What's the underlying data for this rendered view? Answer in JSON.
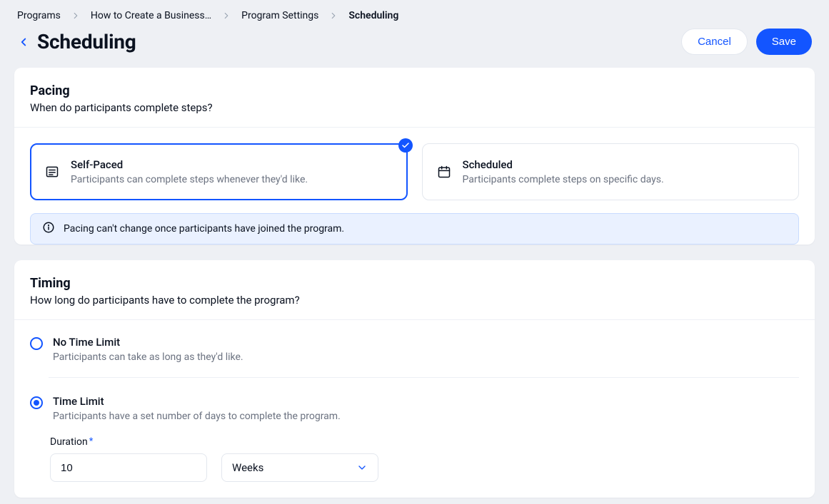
{
  "colors": {
    "accent": "#1355ff"
  },
  "breadcrumb": {
    "items": [
      {
        "label": "Programs"
      },
      {
        "label": "How to Create a Business…"
      },
      {
        "label": "Program Settings"
      },
      {
        "label": "Scheduling"
      }
    ]
  },
  "header": {
    "title": "Scheduling",
    "cancel_label": "Cancel",
    "save_label": "Save"
  },
  "pacing": {
    "heading": "Pacing",
    "subheading": "When do participants complete steps?",
    "options": [
      {
        "key": "self_paced",
        "title": "Self-Paced",
        "desc": "Participants can complete steps whenever they'd like.",
        "selected": true,
        "icon": "list-icon"
      },
      {
        "key": "scheduled",
        "title": "Scheduled",
        "desc": "Participants complete steps on specific days.",
        "selected": false,
        "icon": "calendar-icon"
      }
    ],
    "info": "Pacing can't change once participants have joined the program."
  },
  "timing": {
    "heading": "Timing",
    "subheading": "How long do participants have to complete the program?",
    "options": [
      {
        "key": "no_limit",
        "title": "No Time Limit",
        "desc": "Participants can take as long as they'd like.",
        "selected": false
      },
      {
        "key": "time_limit",
        "title": "Time Limit",
        "desc": "Participants have a set number of days to complete the program.",
        "selected": true
      }
    ],
    "duration": {
      "label": "Duration",
      "required_marker": "*",
      "value": "10",
      "unit": "Weeks"
    }
  }
}
